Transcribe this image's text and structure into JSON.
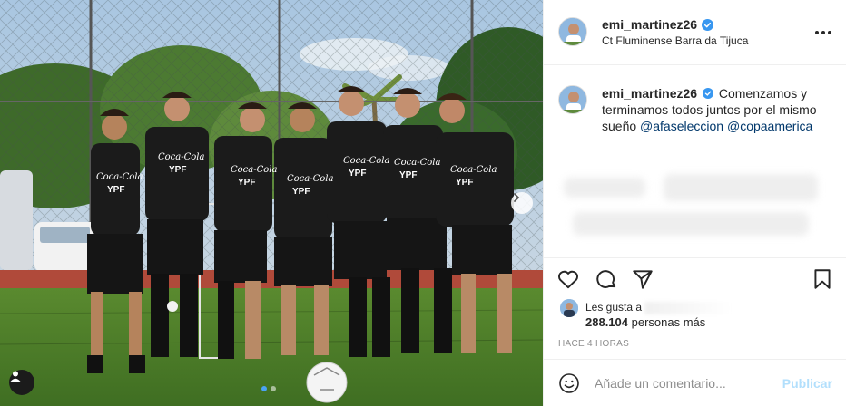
{
  "header": {
    "username": "emi_martinez26",
    "location": "Ct Fluminense Barra da Tijuca",
    "verified_icon": "verified-badge-icon",
    "more_icon": "more-options-icon"
  },
  "photo": {
    "shirt_sponsor_main": "Coca-Cola",
    "shirt_sponsor_sub": "YPF",
    "carousel_total": 2,
    "carousel_active_index": 0,
    "next_icon": "chevron-right-icon",
    "tag_icon": "user-tag-icon"
  },
  "caption": {
    "username": "emi_martinez26",
    "text": "Comenzamos y terminamos todos juntos por el mismo sueño",
    "mentions": [
      "@afaseleccion",
      "@copaamerica"
    ]
  },
  "actions": {
    "like_icon": "heart-icon",
    "comment_icon": "comment-icon",
    "share_icon": "share-icon",
    "save_icon": "bookmark-icon"
  },
  "likes": {
    "prefix": "Les gusta a",
    "count": "288.104",
    "suffix": "personas más"
  },
  "time": "HACE 4 HORAS",
  "comment": {
    "placeholder": "Añade un comentario...",
    "publish_label": "Publicar",
    "emoji_icon": "emoji-icon"
  },
  "colors": {
    "link": "#00376b",
    "verified": "#3897f0",
    "publish_disabled": "#b2dffc",
    "muted": "#8e8e8e"
  }
}
